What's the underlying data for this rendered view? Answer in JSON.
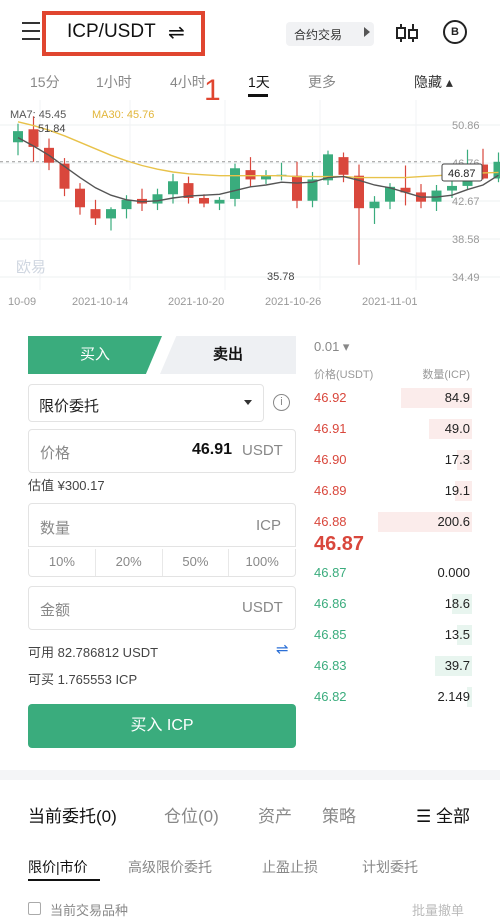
{
  "header": {
    "pair": "ICP/USDT",
    "swap_glyph": "⇌",
    "contract_label": "合约交易",
    "settings_glyph": "B"
  },
  "annotation": {
    "marker": "1"
  },
  "intervals": {
    "items": [
      {
        "label": "15分"
      },
      {
        "label": "1小时"
      },
      {
        "label": "4小时"
      },
      {
        "label": "1天"
      },
      {
        "label": "更多"
      }
    ],
    "active": "1天",
    "hide_label": "隐藏 ▴"
  },
  "chart": {
    "ma7_label": "MA7: 45.45",
    "ma30_label": "MA30: 45.76",
    "high_label": "51.84",
    "low_label": "35.78",
    "watermark": "欧易",
    "current_price_tag": "46.87",
    "colors": {
      "up": "#3aac7d",
      "down": "#d9473c",
      "ma7": "#555555",
      "ma30": "#e8c24a"
    }
  },
  "chart_data": {
    "type": "candlestick",
    "x_labels": [
      "10-09",
      "2021-10-14",
      "2021-10-20",
      "2021-10-26",
      "2021-11-01"
    ],
    "y_ticks": [
      50.86,
      46.76,
      42.67,
      38.58,
      34.49
    ],
    "ylim": [
      34.49,
      50.86
    ],
    "grid": true,
    "candles": [
      {
        "o": 49.0,
        "h": 51.0,
        "l": 47.6,
        "c": 50.2
      },
      {
        "o": 50.4,
        "h": 51.8,
        "l": 46.9,
        "c": 48.5
      },
      {
        "o": 48.4,
        "h": 49.4,
        "l": 46.0,
        "c": 46.8
      },
      {
        "o": 46.7,
        "h": 47.3,
        "l": 43.2,
        "c": 44.0
      },
      {
        "o": 44.0,
        "h": 44.6,
        "l": 41.2,
        "c": 42.0
      },
      {
        "o": 41.8,
        "h": 42.8,
        "l": 40.1,
        "c": 40.8
      },
      {
        "o": 40.8,
        "h": 42.0,
        "l": 39.5,
        "c": 41.8
      },
      {
        "o": 41.8,
        "h": 43.3,
        "l": 40.8,
        "c": 42.8
      },
      {
        "o": 42.9,
        "h": 44.0,
        "l": 41.6,
        "c": 42.4
      },
      {
        "o": 42.4,
        "h": 44.0,
        "l": 41.7,
        "c": 43.4
      },
      {
        "o": 43.4,
        "h": 45.6,
        "l": 42.4,
        "c": 44.8
      },
      {
        "o": 44.6,
        "h": 45.3,
        "l": 42.4,
        "c": 43.0
      },
      {
        "o": 43.0,
        "h": 43.4,
        "l": 42.0,
        "c": 42.4
      },
      {
        "o": 42.4,
        "h": 43.1,
        "l": 41.7,
        "c": 42.8
      },
      {
        "o": 42.9,
        "h": 46.7,
        "l": 42.1,
        "c": 46.2
      },
      {
        "o": 46.0,
        "h": 47.4,
        "l": 44.2,
        "c": 45.0
      },
      {
        "o": 45.0,
        "h": 46.0,
        "l": 44.5,
        "c": 45.4
      },
      {
        "o": 45.5,
        "h": 46.8,
        "l": 44.9,
        "c": 45.5
      },
      {
        "o": 45.4,
        "h": 46.9,
        "l": 41.9,
        "c": 42.7
      },
      {
        "o": 42.7,
        "h": 45.8,
        "l": 42.0,
        "c": 45.0
      },
      {
        "o": 44.9,
        "h": 48.1,
        "l": 44.4,
        "c": 47.7
      },
      {
        "o": 47.4,
        "h": 47.9,
        "l": 44.7,
        "c": 45.5
      },
      {
        "o": 45.4,
        "h": 46.6,
        "l": 35.8,
        "c": 41.9
      },
      {
        "o": 41.9,
        "h": 43.2,
        "l": 40.2,
        "c": 42.6
      },
      {
        "o": 42.6,
        "h": 44.6,
        "l": 41.8,
        "c": 44.2
      },
      {
        "o": 44.1,
        "h": 46.5,
        "l": 42.2,
        "c": 43.6
      },
      {
        "o": 43.6,
        "h": 44.5,
        "l": 41.9,
        "c": 42.6
      },
      {
        "o": 42.6,
        "h": 44.4,
        "l": 41.6,
        "c": 43.8
      },
      {
        "o": 43.8,
        "h": 44.8,
        "l": 43.0,
        "c": 44.3
      },
      {
        "o": 44.3,
        "h": 48.2,
        "l": 43.9,
        "c": 46.4
      },
      {
        "o": 46.6,
        "h": 48.3,
        "l": 45.0,
        "c": 45.1
      },
      {
        "o": 45.1,
        "h": 47.9,
        "l": 44.7,
        "c": 46.9
      }
    ],
    "ma7": [
      49.5,
      48.6,
      47.6,
      46.4,
      45.2,
      44.1,
      43.3,
      42.8,
      42.6,
      42.7,
      43.0,
      43.2,
      43.3,
      43.4,
      43.8,
      44.2,
      44.4,
      44.7,
      44.6,
      44.7,
      45.2,
      45.3,
      44.9,
      44.4,
      44.1,
      43.6,
      43.1,
      43.1,
      43.3,
      43.9,
      44.4,
      45.45
    ],
    "ma30": [
      51.2,
      50.8,
      50.3,
      49.7,
      49.0,
      48.3,
      47.6,
      47.0,
      46.5,
      46.1,
      45.8,
      45.6,
      45.5,
      45.4,
      45.4,
      45.4,
      45.4,
      45.4,
      45.3,
      45.3,
      45.3,
      45.3,
      45.2,
      45.2,
      45.2,
      45.2,
      45.3,
      45.4,
      45.5,
      45.6,
      45.7,
      45.76
    ]
  },
  "order_form": {
    "buy_tab": "买入",
    "sell_tab": "卖出",
    "order_type": "限价委托",
    "price_label": "价格",
    "price_value": "46.91",
    "price_unit": "USDT",
    "estimate": "估值 ¥300.17",
    "qty_label": "数量",
    "qty_unit": "ICP",
    "percents": [
      "10%",
      "20%",
      "50%",
      "100%"
    ],
    "amount_label": "金额",
    "amount_unit": "USDT",
    "available": "可用 82.786812 USDT",
    "buyable": "可买 1.765553 ICP",
    "buy_button": "买入 ICP"
  },
  "order_book": {
    "precision": "0.01 ▾",
    "header_price": "价格(USDT)",
    "header_qty": "数量(ICP)",
    "asks": [
      {
        "price": "46.92",
        "qty": "84.9",
        "depth": 0.42
      },
      {
        "price": "46.91",
        "qty": "49.0",
        "depth": 0.25
      },
      {
        "price": "46.90",
        "qty": "17.3",
        "depth": 0.09
      },
      {
        "price": "46.89",
        "qty": "19.1",
        "depth": 0.1
      },
      {
        "price": "46.88",
        "qty": "200.6",
        "depth": 0.55
      }
    ],
    "last_price": "46.87",
    "bids": [
      {
        "price": "46.87",
        "qty": "0.000",
        "depth": 0.0
      },
      {
        "price": "46.86",
        "qty": "18.6",
        "depth": 0.12
      },
      {
        "price": "46.85",
        "qty": "13.5",
        "depth": 0.09
      },
      {
        "price": "46.83",
        "qty": "39.7",
        "depth": 0.22
      },
      {
        "price": "46.82",
        "qty": "2.149",
        "depth": 0.03
      }
    ]
  },
  "bottom": {
    "tabs": [
      "当前委托(0)",
      "仓位(0)",
      "资产",
      "策略"
    ],
    "all_label": "全部",
    "subtabs": [
      "限价|市价",
      "高级限价委托",
      "止盈止损",
      "计划委托"
    ],
    "current_pair_only": "当前交易品种",
    "batch_cancel": "批量撤单"
  }
}
